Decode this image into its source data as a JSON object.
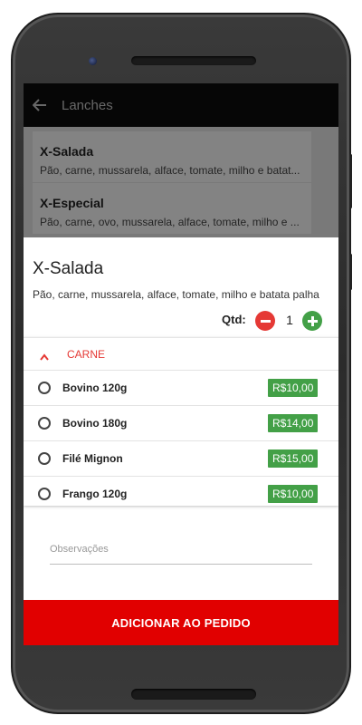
{
  "appbar": {
    "title": "Lanches"
  },
  "background_list": [
    {
      "name": "X-Salada",
      "description": "Pão, carne, mussarela, alface, tomate, milho e batat..."
    },
    {
      "name": "X-Especial",
      "description": "Pão, carne, ovo, mussarela, alface, tomate, milho e ..."
    }
  ],
  "product": {
    "title": "X-Salada",
    "description": "Pão, carne, mussarela, alface, tomate, milho e batata palha"
  },
  "quantity": {
    "label": "Qtd:",
    "value": "1"
  },
  "option_group": {
    "title": "CARNE",
    "options": [
      {
        "name": "Bovino 120g",
        "price": "R$10,00",
        "selected": false
      },
      {
        "name": "Bovino 180g",
        "price": "R$14,00",
        "selected": false
      },
      {
        "name": "Filé Mignon",
        "price": "R$15,00",
        "selected": false
      },
      {
        "name": "Frango 120g",
        "price": "R$10,00",
        "selected": false
      }
    ]
  },
  "observations": {
    "placeholder": "Observações"
  },
  "add_button": {
    "label": "ADICIONAR AO PEDIDO"
  },
  "colors": {
    "accent": "#e10000",
    "price_badge": "#43a047",
    "minus": "#e53935",
    "plus": "#43a047"
  }
}
